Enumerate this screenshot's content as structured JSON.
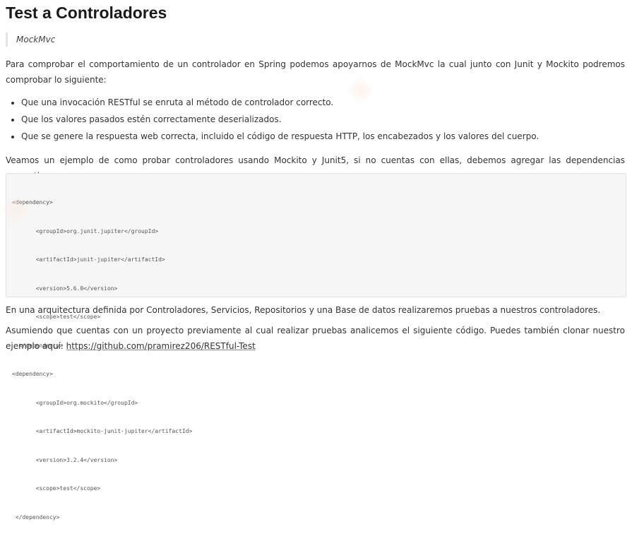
{
  "heading": "Test a Controladores",
  "quote": "MockMvc",
  "intro": "Para comprobar el comportamiento de un controlador en Spring podemos apoyarnos de MockMvc la cual junto con Junit y Mockito podremos comprobar lo siguiente:",
  "bullets": [
    "Que una invocación RESTful se enruta al método de controlador correcto.",
    "Que los valores pasados estén correctamente deserializados.",
    "Que se genere la respuesta web correcta, incluido el código de respuesta HTTP, los encabezados y los valores del cuerpo."
  ],
  "example_intro": "Veamos un ejemplo de como probar controladores usando Mockito y Junit5, si no cuentas con ellas, debemos agregar las dependencias respectivas:",
  "code_lines": [
    "<dependency>",
    "       <groupId>org.junit.jupiter</groupId>",
    "       <artifactId>junit-jupiter</artifactId>",
    "       <version>5.6.0</version>",
    "       <scope>test</scope>",
    "  </dependency>",
    "<dependency>",
    "       <groupId>org.mockito</groupId>",
    "       <artifactId>mockito-junit-jupiter</artifactId>",
    "       <version>3.2.4</version>",
    "       <scope>test</scope>",
    " </dependency>"
  ],
  "architecture": "En una arquitectura definida por Controladores, Servicios, Repositorios y una Base de datos realizaremos pruebas a nuestros controladores.",
  "closing_text": "Asumiendo que cuentas con un proyecto previamente al cual realizar pruebas analicemos el siguiente código. Puedes también clonar nuestro ejemplo aquí: ",
  "link_text": "https://github.com/pramirez206/RESTful-Test"
}
